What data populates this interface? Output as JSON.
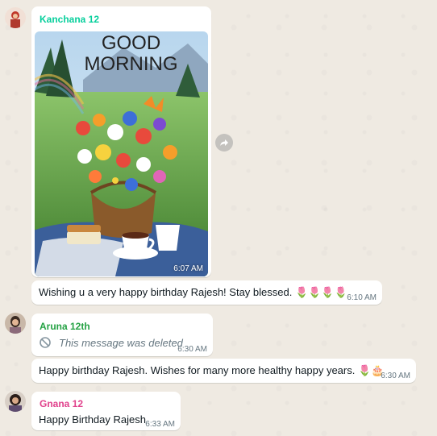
{
  "messages": {
    "m1": {
      "sender": "Kanchana 12",
      "image_text_line1": "GOOD",
      "image_text_line2": "MORNING",
      "image_time": "6:07 AM"
    },
    "m2": {
      "text": "Wishing u a very happy birthday Rajesh! Stay blessed. 🌷🌷🌷🌷",
      "time": "6:10 AM"
    },
    "m3": {
      "sender": "Aruna 12th",
      "deleted_text": "This message was deleted",
      "time": "6:30 AM"
    },
    "m4": {
      "text": "Happy birthday Rajesh. Wishes for many more healthy happy years. 🌷🎂",
      "time": "6:30 AM"
    },
    "m5": {
      "sender": "Gnana 12",
      "text": "Happy Birthday Rajesh",
      "time": "6:33 AM"
    }
  },
  "colors": {
    "kanchana": "#06cf9c",
    "aruna": "#25a244",
    "gnana": "#e0418c",
    "bubble": "#ffffff",
    "background": "#efeae2"
  },
  "icons": {
    "forward": "forward-icon",
    "deleted": "deleted-icon"
  }
}
